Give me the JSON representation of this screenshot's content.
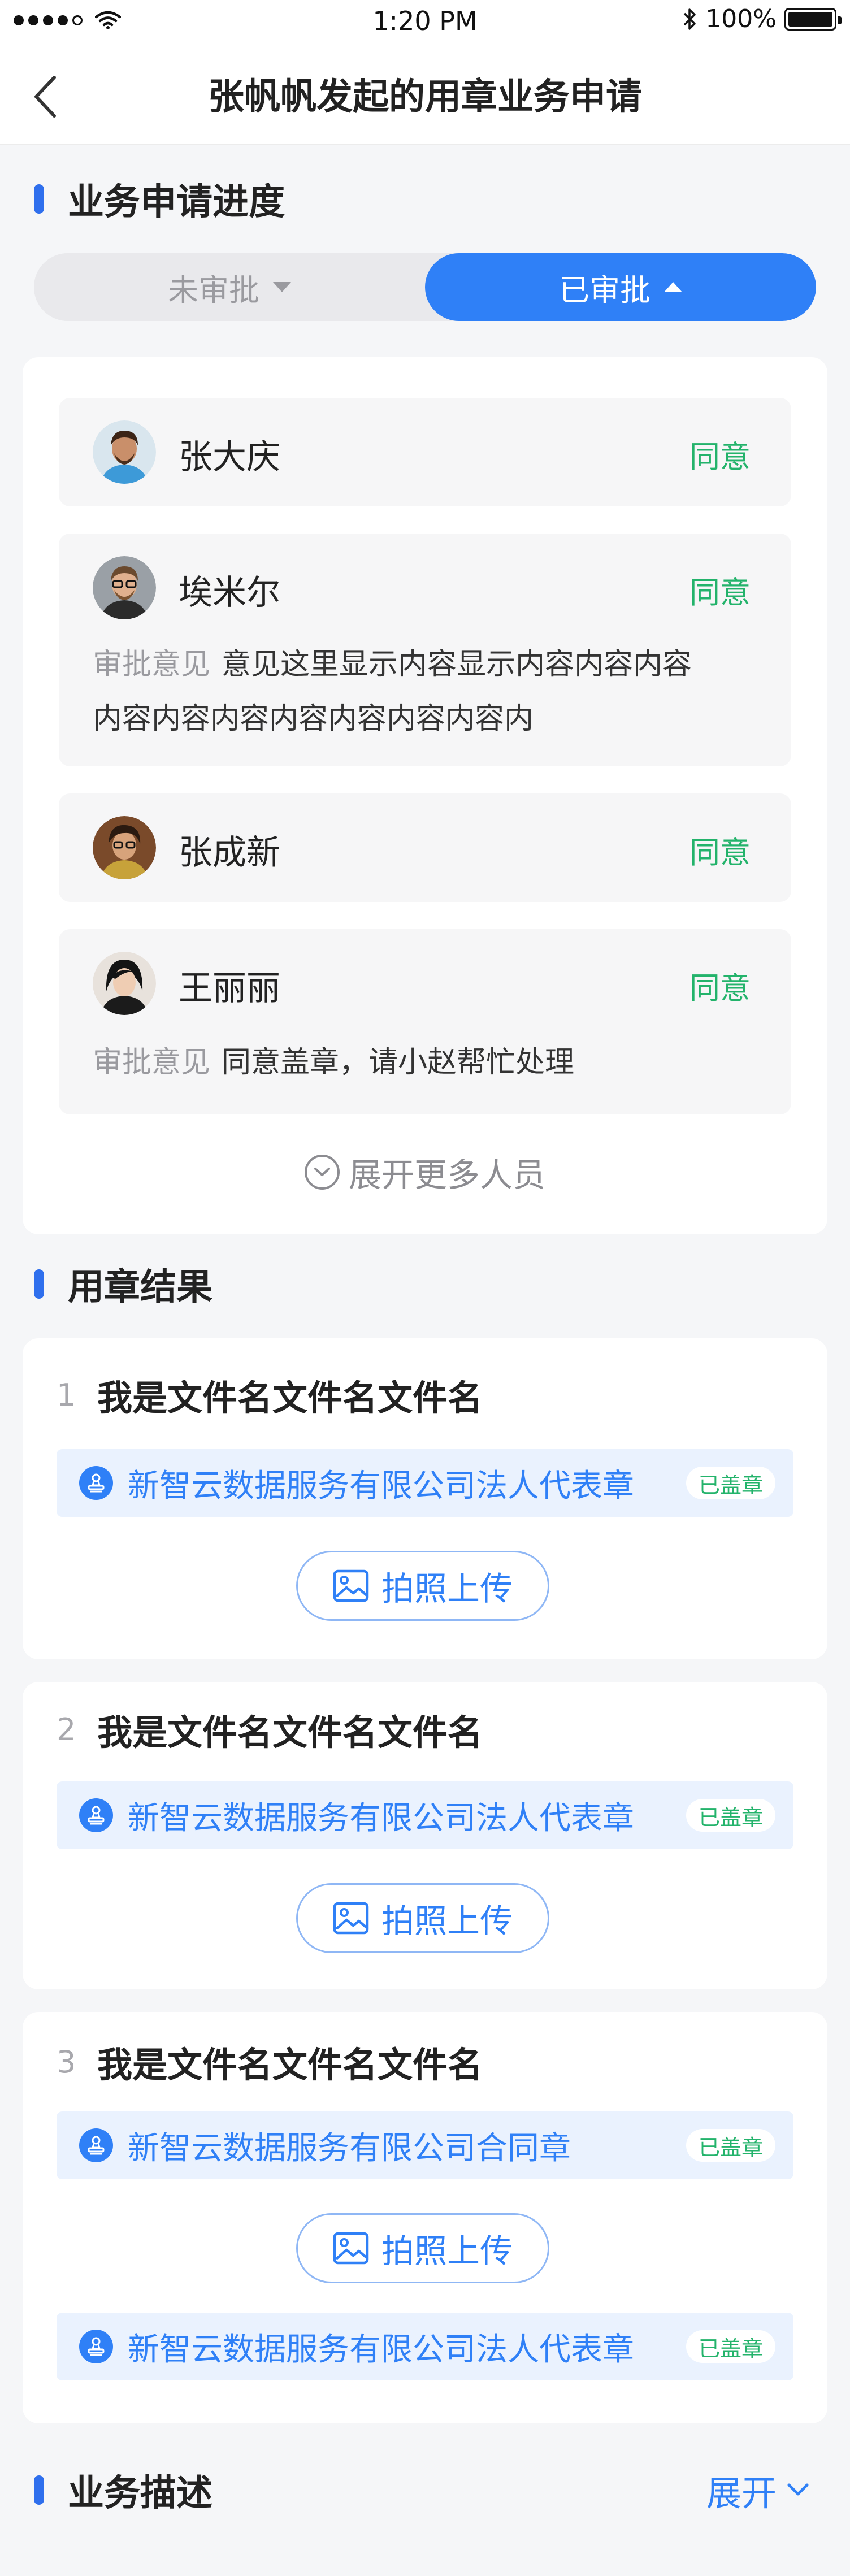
{
  "status_bar": {
    "time": "1:20 PM",
    "battery": "100%"
  },
  "nav": {
    "title": "张帆帆发起的用章业务申请"
  },
  "progress": {
    "title": "业务申请进度",
    "tabs": [
      {
        "label": "未审批",
        "active": false
      },
      {
        "label": "已审批",
        "active": true
      }
    ],
    "approvers": [
      {
        "name": "张大庆",
        "status": "同意",
        "opinion_label": "",
        "opinion": ""
      },
      {
        "name": "埃米尔",
        "status": "同意",
        "opinion_label": "审批意见",
        "opinion": "意见这里显示内容显示内容内容内容内容内容内容内容内容内容内容内"
      },
      {
        "name": "张成新",
        "status": "同意",
        "opinion_label": "",
        "opinion": ""
      },
      {
        "name": "王丽丽",
        "status": "同意",
        "opinion_label": "审批意见",
        "opinion": "同意盖章，请小赵帮忙处理"
      }
    ],
    "expand_more": "展开更多人员"
  },
  "seal_result": {
    "title": "用章结果",
    "files": [
      {
        "index": "1",
        "name": "我是文件名文件名文件名",
        "seals": [
          {
            "name": "新智云数据服务有限公司法人代表章",
            "badge": "已盖章"
          }
        ],
        "upload_label": "拍照上传"
      },
      {
        "index": "2",
        "name": "我是文件名文件名文件名",
        "seals": [
          {
            "name": "新智云数据服务有限公司法人代表章",
            "badge": "已盖章"
          }
        ],
        "upload_label": "拍照上传"
      },
      {
        "index": "3",
        "name": "我是文件名文件名文件名",
        "seals": [
          {
            "name": "新智云数据服务有限公司合同章",
            "badge": "已盖章"
          },
          {
            "name": "新智云数据服务有限公司法人代表章",
            "badge": "已盖章"
          }
        ],
        "upload_label": "拍照上传"
      }
    ]
  },
  "description": {
    "title": "业务描述",
    "toggle_label": "展开"
  },
  "colors": {
    "accent": "#2f80f7",
    "agree": "#23b36b",
    "background": "#f5f6f8"
  }
}
